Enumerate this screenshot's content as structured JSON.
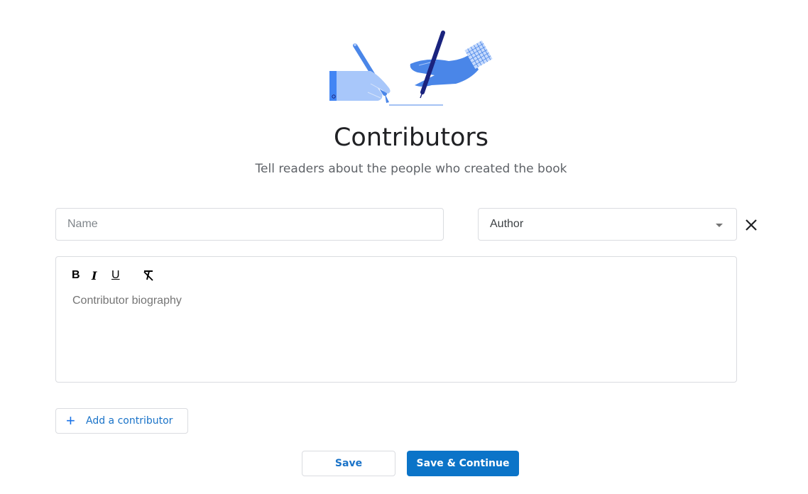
{
  "header": {
    "title": "Contributors",
    "subtitle": "Tell readers about the people who created the book",
    "illustration": "hands-writing-illustration"
  },
  "form": {
    "name": {
      "value": "",
      "placeholder": "Name"
    },
    "role": {
      "selected": "Author"
    },
    "remove_icon": "close-icon",
    "biography": {
      "toolbar": {
        "bold": "B",
        "italic": "I",
        "underline": "U",
        "clear_format_icon": "clear-formatting-icon"
      },
      "placeholder": "Contributor biography"
    },
    "add_contributor": {
      "icon": "plus-icon",
      "label": "Add a contributor"
    }
  },
  "actions": {
    "save_label": "Save",
    "save_continue_label": "Save & Continue"
  },
  "colors": {
    "accent": "#1a73e8",
    "primary_button": "#0b74c8",
    "border": "#dadce0"
  }
}
